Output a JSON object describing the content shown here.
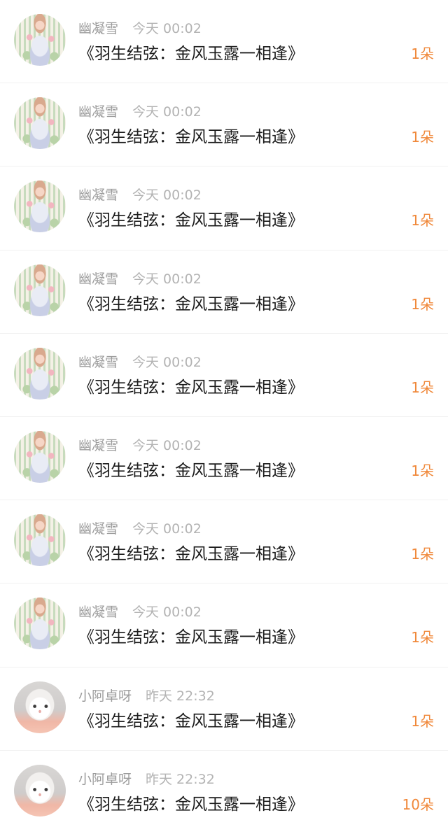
{
  "colors": {
    "accent": "#f0883a",
    "username": "#9c9c9c",
    "timestamp": "#b3b3b3",
    "title": "#1b1b1b"
  },
  "list": {
    "items": [
      {
        "avatar": "anime-illustration-avatar",
        "user": "幽凝雪",
        "time": "今天 00:02",
        "title": "《羽生结弦：金风玉露一相逢》",
        "count": "1朵"
      },
      {
        "avatar": "anime-illustration-avatar",
        "user": "幽凝雪",
        "time": "今天 00:02",
        "title": "《羽生结弦：金风玉露一相逢》",
        "count": "1朵"
      },
      {
        "avatar": "anime-illustration-avatar",
        "user": "幽凝雪",
        "time": "今天 00:02",
        "title": "《羽生结弦：金风玉露一相逢》",
        "count": "1朵"
      },
      {
        "avatar": "anime-illustration-avatar",
        "user": "幽凝雪",
        "time": "今天 00:02",
        "title": "《羽生结弦：金风玉露一相逢》",
        "count": "1朵"
      },
      {
        "avatar": "anime-illustration-avatar",
        "user": "幽凝雪",
        "time": "今天 00:02",
        "title": "《羽生结弦：金风玉露一相逢》",
        "count": "1朵"
      },
      {
        "avatar": "anime-illustration-avatar",
        "user": "幽凝雪",
        "time": "今天 00:02",
        "title": "《羽生结弦：金风玉露一相逢》",
        "count": "1朵"
      },
      {
        "avatar": "anime-illustration-avatar",
        "user": "幽凝雪",
        "time": "今天 00:02",
        "title": "《羽生结弦：金风玉露一相逢》",
        "count": "1朵"
      },
      {
        "avatar": "anime-illustration-avatar",
        "user": "幽凝雪",
        "time": "今天 00:02",
        "title": "《羽生结弦：金风玉露一相逢》",
        "count": "1朵"
      },
      {
        "avatar": "cat-photo-avatar",
        "user": "小阿卓呀",
        "time": "昨天 22:32",
        "title": "《羽生结弦：金风玉露一相逢》",
        "count": "1朵"
      },
      {
        "avatar": "cat-photo-avatar",
        "user": "小阿卓呀",
        "time": "昨天 22:32",
        "title": "《羽生结弦：金风玉露一相逢》",
        "count": "10朵"
      }
    ]
  }
}
